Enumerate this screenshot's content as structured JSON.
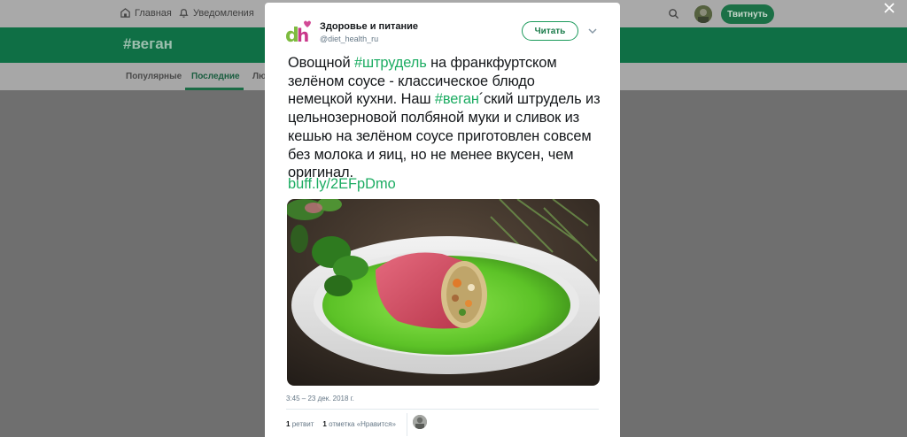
{
  "topnav": {
    "home_label": "Главная",
    "notifications_label": "Уведомления",
    "tweet_button_label": "Твитнуть"
  },
  "hashtag_header": "#веган",
  "tabs": [
    {
      "label": "Популярные"
    },
    {
      "label": "Последние"
    },
    {
      "label": "Лю"
    }
  ],
  "tweet": {
    "author_name": "Здоровье и питание",
    "author_handle": "@diet_health_ru",
    "follow_label": "Читать",
    "text_part1": "Овощной ",
    "hashtag1": "#штрудель",
    "text_part2": " на франкфуртском зелёном соусе - классическое блюдо немецкой кухни. Наш ",
    "hashtag2": "#веган",
    "text_part3": "´ский штрудель из цельнозерновой полбяной муки и сливок из кешью на зелёном соусе приготовлен совсем без молока и яиц, но не менее вкусен, чем оригинал.",
    "link": "buff.ly/2EFpDmo",
    "timestamp": "3:45 – 23 дек. 2018 г.",
    "retweets_count": "1",
    "retweets_label": "ретвит",
    "likes_count": "1",
    "likes_label": "отметка «Нравится»"
  },
  "colors": {
    "accent": "#1cac62",
    "header_green": "#0f6f45"
  }
}
